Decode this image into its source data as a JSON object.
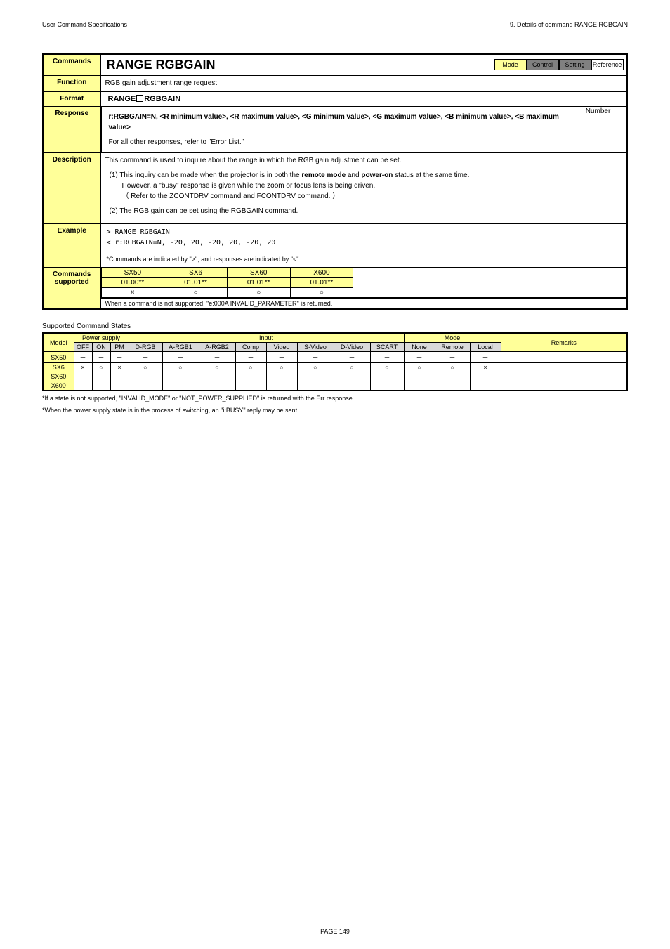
{
  "header": {
    "left": "User Command Specifications",
    "right": "9. Details of command  RANGE RGBGAIN"
  },
  "cmd": {
    "row_commands": "Commands",
    "title": "RANGE RGBGAIN",
    "badges": {
      "mode": "Mode",
      "control": "Control",
      "setting": "Setting",
      "reference": "Reference"
    },
    "row_function": "Function",
    "function_text": "RGB gain adjustment range request",
    "row_format": "Format",
    "format_prefix": "RANGE",
    "format_suffix": "RGBGAIN",
    "row_response": "Response",
    "response_body_1": "r:RGBGAIN=N, <R minimum value>, <R maximum value>, <G minimum value>, <G maximum value>, <B minimum value>, <B maximum value>",
    "response_body_2": "For all other responses, refer to \"Error List.\"",
    "response_right": "Number",
    "row_description": "Description",
    "desc_intro": "This command is used to inquire about the range in which the RGB gain adjustment can be set.",
    "desc_1_a": "(1) This inquiry can be made when the projector is in both the ",
    "desc_1_remote": "remote mode",
    "desc_1_and": " and ",
    "desc_1_power": "power-on",
    "desc_1_b": " status at the same time.",
    "desc_1_c": "However, a \"busy\" response is given while the zoom or focus lens is being driven.",
    "desc_1_d": "（ Refer to the ZCONTDRV command and FCONTDRV command. ）",
    "desc_2": "(2) The RGB gain can be set using the RGBGAIN command.",
    "row_example": "Example",
    "example_1": "> RANGE RGBGAIN",
    "example_2": "< r:RGBGAIN=N, -20, 20, -20, 20, -20, 20",
    "example_note": "*Commands are indicated by \">\", and responses are indicated by \"<\".",
    "row_cs1": "Commands",
    "row_cs2": "supported",
    "vers_models": [
      "SX50",
      "SX6",
      "SX60",
      "X600"
    ],
    "vers_vals": [
      "01.00**",
      "01.01**",
      "01.01**",
      "01.01**"
    ],
    "vers_marks": [
      "×",
      "○",
      "○",
      "○"
    ],
    "vers_note": "When a command is not supported, \"e:000A INVALID_PARAMETER\" is returned."
  },
  "states_title": "Supported Command States",
  "states": {
    "head": {
      "model": "Model",
      "power": "Power supply",
      "input": "Input",
      "mode": "Mode",
      "remarks": "Remarks",
      "cols": [
        "OFF",
        "ON",
        "PM",
        "D-RGB",
        "A-RGB1",
        "A-RGB2",
        "Comp",
        "Video",
        "S-Video",
        "D-Video",
        "SCART",
        "None",
        "Remote",
        "Local"
      ]
    },
    "rows": [
      {
        "model": "SX50",
        "cells": [
          "－",
          "－",
          "－",
          "－",
          "－",
          "－",
          "－",
          "－",
          "－",
          "－",
          "－",
          "－",
          "－",
          "－",
          ""
        ]
      },
      {
        "model": "SX6",
        "cells": [
          "×",
          "○",
          "×",
          "○",
          "○",
          "○",
          "○",
          "○",
          "○",
          "○",
          "○",
          "○",
          "○",
          "×",
          ""
        ]
      },
      {
        "model": "SX60",
        "cells": [
          "",
          "",
          "",
          "",
          "",
          "",
          "",
          "",
          "",
          "",
          "",
          "",
          "",
          "",
          ""
        ]
      },
      {
        "model": "X600",
        "cells": [
          "",
          "",
          "",
          "",
          "",
          "",
          "",
          "",
          "",
          "",
          "",
          "",
          "",
          "",
          ""
        ]
      }
    ]
  },
  "foot": {
    "n1": "*If a state is not supported, \"INVALID_MODE\" or \"NOT_POWER_SUPPLIED\" is returned with the Err response.",
    "n2": "*When the power supply state is in the process of switching, an \"i:BUSY\" reply may be sent."
  },
  "page": "PAGE 149",
  "chart_data": {
    "type": "table",
    "title": "Supported Command States",
    "columns": [
      "Model",
      "OFF",
      "ON",
      "PM",
      "D-RGB",
      "A-RGB1",
      "A-RGB2",
      "Comp",
      "Video",
      "S-Video",
      "D-Video",
      "SCART",
      "None",
      "Remote",
      "Local",
      "Remarks"
    ],
    "rows": [
      [
        "SX50",
        "－",
        "－",
        "－",
        "－",
        "－",
        "－",
        "－",
        "－",
        "－",
        "－",
        "－",
        "－",
        "－",
        "－",
        ""
      ],
      [
        "SX6",
        "×",
        "○",
        "×",
        "○",
        "○",
        "○",
        "○",
        "○",
        "○",
        "○",
        "○",
        "○",
        "○",
        "×",
        ""
      ],
      [
        "SX60",
        "",
        "",
        "",
        "",
        "",
        "",
        "",
        "",
        "",
        "",
        "",
        "",
        "",
        "",
        ""
      ],
      [
        "X600",
        "",
        "",
        "",
        "",
        "",
        "",
        "",
        "",
        "",
        "",
        "",
        "",
        "",
        "",
        ""
      ]
    ]
  }
}
